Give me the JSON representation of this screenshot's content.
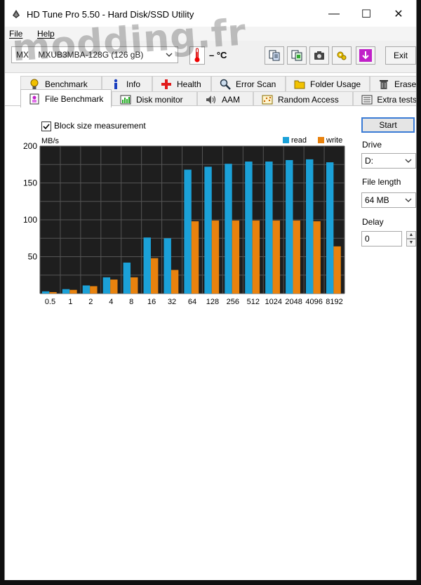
{
  "window": {
    "title": "HD Tune Pro 5.50 - Hard Disk/SSD Utility",
    "minimize_label": "—",
    "maximize_label": "☐",
    "close_label": "✕"
  },
  "watermark": "modding.fr",
  "menu": {
    "file_label": "File",
    "help_label": "Help"
  },
  "toolbar": {
    "drive_select_value": "MX    MXUB3MBA-128G (126 gB)",
    "temperature": "– °C",
    "exit_label": "Exit",
    "buttons": [
      "copy-text-icon",
      "copy-info-icon",
      "screenshot-icon",
      "options-icon",
      "save-icon"
    ]
  },
  "tabs_row1": [
    "Benchmark",
    "Info",
    "Health",
    "Error Scan",
    "Folder Usage",
    "Erase"
  ],
  "tabs_row2": [
    "File Benchmark",
    "Disk monitor",
    "AAM",
    "Random Access",
    "Extra tests"
  ],
  "active_tab": "File Benchmark",
  "panel": {
    "block_size_label": "Block size measurement",
    "block_size_checked": true,
    "start_label": "Start",
    "drive_label": "Drive",
    "drive_value": "D:",
    "file_length_label": "File length",
    "file_length_value": "64 MB",
    "delay_label": "Delay",
    "delay_value": "0"
  },
  "colors": {
    "read": "#1ba1d8",
    "write": "#e8820e",
    "chart_bg": "#1e1e1e",
    "grid": "#555555"
  },
  "chart_data": {
    "type": "bar",
    "ylabel": "MB/s",
    "ylim": [
      0,
      200
    ],
    "yticks": [
      50,
      100,
      150,
      200
    ],
    "categories": [
      "0.5",
      "1",
      "2",
      "4",
      "8",
      "16",
      "32",
      "64",
      "128",
      "256",
      "512",
      "1024",
      "2048",
      "4096",
      "8192"
    ],
    "series": [
      {
        "name": "read",
        "values": [
          3,
          6,
          11,
          22,
          42,
          76,
          75,
          168,
          172,
          176,
          179,
          179,
          181,
          182,
          178
        ]
      },
      {
        "name": "write",
        "values": [
          2,
          5,
          10,
          19,
          22,
          48,
          32,
          98,
          99,
          99,
          99,
          99,
          99,
          98,
          64
        ]
      }
    ],
    "legend_position": "top-right",
    "grid": true
  }
}
